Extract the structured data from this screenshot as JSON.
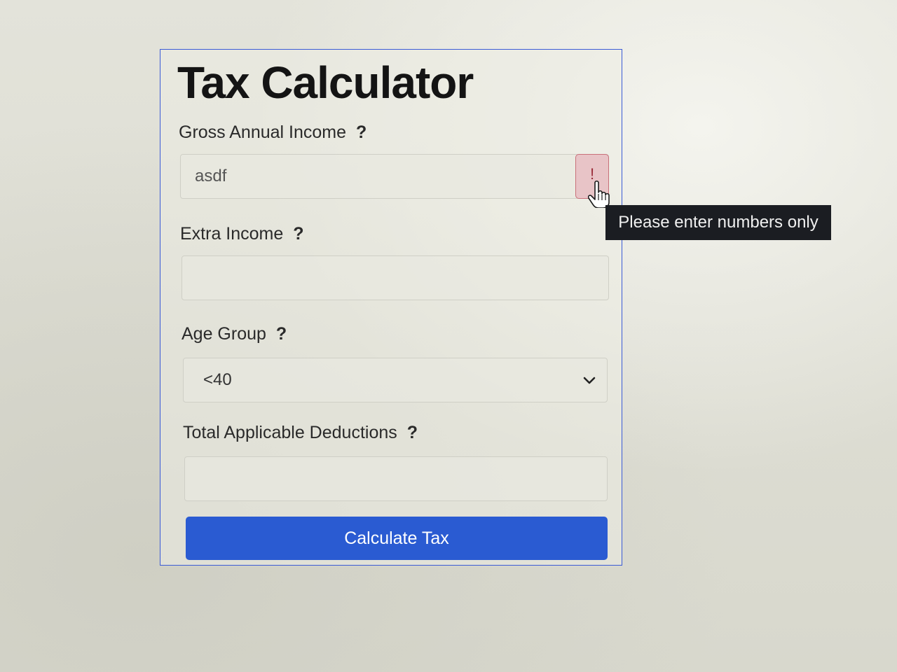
{
  "app": {
    "title": "Tax Calculator"
  },
  "fields": {
    "gross_income": {
      "label": "Gross Annual Income",
      "help": "?",
      "value": "asdf",
      "error_icon": "!"
    },
    "extra_income": {
      "label": "Extra Income",
      "help": "?",
      "value": ""
    },
    "age_group": {
      "label": "Age Group",
      "help": "?",
      "selected": "<40"
    },
    "deductions": {
      "label": "Total Applicable Deductions",
      "help": "?",
      "value": ""
    }
  },
  "tooltip": {
    "text": "Please enter numbers only"
  },
  "actions": {
    "calculate_label": "Calculate Tax"
  },
  "colors": {
    "accent": "#2a5bd2",
    "error_bg": "#e8c4c7",
    "tooltip_bg": "#1b1d22",
    "card_border": "#3b5bd6"
  },
  "icons": {
    "select": "chevron-down-icon",
    "cursor": "hand-pointer-icon"
  }
}
